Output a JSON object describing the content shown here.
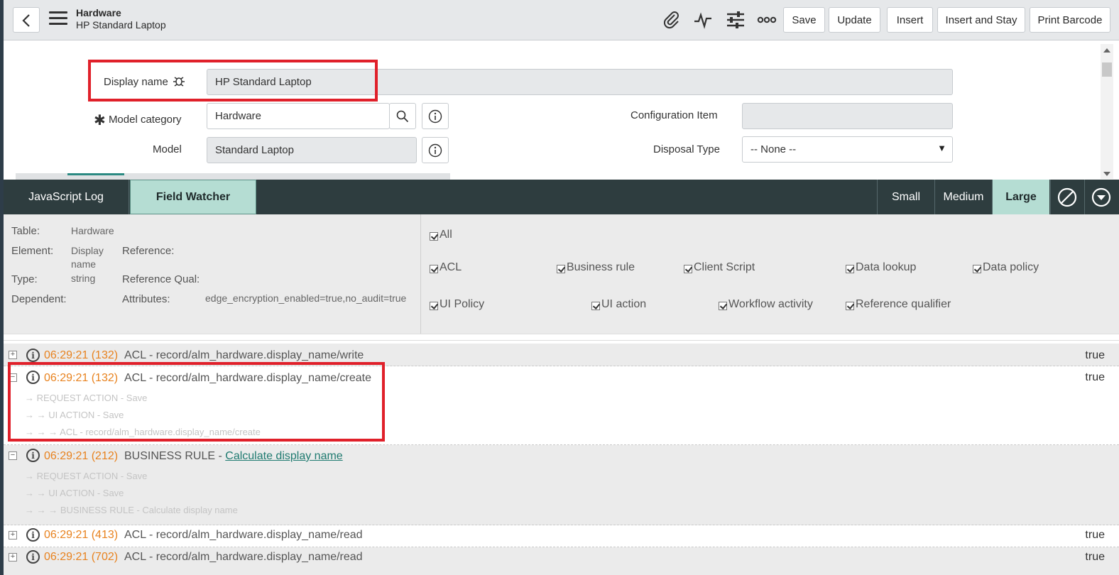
{
  "header": {
    "title": "Hardware",
    "subtitle": "HP Standard Laptop",
    "buttons": {
      "save": "Save",
      "update": "Update",
      "insert": "Insert",
      "insert_stay": "Insert and Stay",
      "print_barcode": "Print Barcode"
    },
    "icons": [
      "paperclip-icon",
      "activity-icon",
      "sliders-icon",
      "more-icon"
    ]
  },
  "form": {
    "display_name": {
      "label": "Display name",
      "value": "HP Standard Laptop"
    },
    "model_category": {
      "label": "Model category",
      "value": "Hardware",
      "required": true
    },
    "model": {
      "label": "Model",
      "value": "Standard Laptop"
    },
    "configuration_item": {
      "label": "Configuration Item",
      "value": ""
    },
    "disposal_type": {
      "label": "Disposal Type",
      "value": "-- None --"
    }
  },
  "debug": {
    "tabs": {
      "js_log": "JavaScript Log",
      "field_watcher": "Field Watcher"
    },
    "sizes": {
      "small": "Small",
      "medium": "Medium",
      "large": "Large"
    },
    "active_size": "Large"
  },
  "info": {
    "table_label": "Table:",
    "table_value": "Hardware",
    "element_label": "Element:",
    "element_value_1": "Display",
    "element_value_2": "name",
    "type_label": "Type:",
    "type_value": "string",
    "dependent_label": "Dependent:",
    "reference_label": "Reference:",
    "reference_qual_label": "Reference Qual:",
    "attributes_label": "Attributes:",
    "attributes_value": "edge_encryption_enabled=true,no_audit=true"
  },
  "filters": {
    "all": "All",
    "acl": "ACL",
    "business_rule": "Business rule",
    "client_script": "Client Script",
    "data_lookup": "Data lookup",
    "data_policy": "Data policy",
    "ui_policy": "UI Policy",
    "ui_action": "UI action",
    "workflow_activity": "Workflow activity",
    "reference_qualifier": "Reference qualifier"
  },
  "log": [
    {
      "time": "06:29:21 (132)",
      "text": "ACL - record/alm_hardware.display_name/write",
      "result": "true"
    },
    {
      "time": "06:29:21 (132)",
      "text": "ACL - record/alm_hardware.display_name/create",
      "result": "true",
      "trace": [
        "→ REQUEST ACTION - Save",
        "→ → UI ACTION - Save",
        "→ → → ACL - record/alm_hardware.display_name/create"
      ]
    },
    {
      "time": "06:29:21 (212)",
      "text_prefix": "BUSINESS RULE - ",
      "link": "Calculate display name",
      "result": "",
      "trace": [
        "→ REQUEST ACTION - Save",
        "→ → UI ACTION - Save",
        "→ → → BUSINESS RULE - Calculate display name"
      ]
    },
    {
      "time": "06:29:21 (413)",
      "text": "ACL - record/alm_hardware.display_name/read",
      "result": "true"
    },
    {
      "time": "06:29:21 (702)",
      "text": "ACL - record/alm_hardware.display_name/read",
      "result": "true"
    }
  ],
  "colors": {
    "accent": "#b5ddd3",
    "toolbar": "#2e3d3f",
    "highlight": "#e0202a",
    "time": "#e8821e"
  }
}
